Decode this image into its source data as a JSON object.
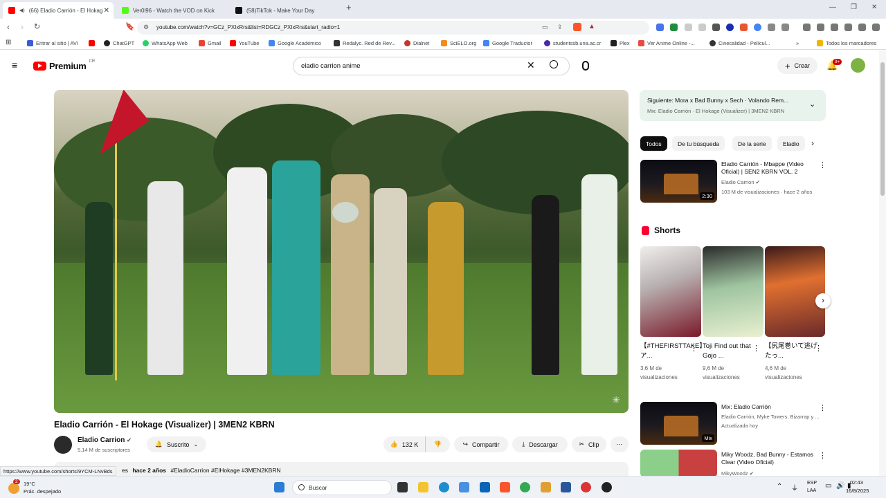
{
  "browser": {
    "tabs": [
      {
        "label": "(66) Eladio Carrión - El Hokag",
        "favicon_color": "#ff0000"
      },
      {
        "label": "Ver0l96 - Watch the VOD on Kick",
        "favicon_color": "#53fc18"
      },
      {
        "label": "(58)TikTok - Make Your Day",
        "favicon_color": "#111111"
      }
    ],
    "url": "youtube.com/watch?v=GCz_PXIxRrs&list=RDGCz_PXIxRrs&start_radio=1",
    "bookmarks": [
      {
        "label": "Entrar al sitio | AVI",
        "color": "#3b5bdb"
      },
      {
        "label": "",
        "color": "#ff0000"
      },
      {
        "label": "ChatGPT",
        "color": "#222222"
      },
      {
        "label": "WhatsApp Web",
        "color": "#25d366"
      },
      {
        "label": "Gmail",
        "color": "#ea4335"
      },
      {
        "label": "YouTube",
        "color": "#ff0000"
      },
      {
        "label": "Google Académico",
        "color": "#4285f4"
      },
      {
        "label": "Redalyc. Red de Rev...",
        "color": "#333333"
      },
      {
        "label": "Dialnet",
        "color": "#c0392b"
      },
      {
        "label": "SciELO.org",
        "color": "#f28b20"
      },
      {
        "label": "Google Traductor",
        "color": "#4285f4"
      },
      {
        "label": "studentssb.una.ac.cr",
        "color": "#4b2aa8"
      },
      {
        "label": "Plex",
        "color": "#1f1f1f"
      },
      {
        "label": "Ver Anime Online -...",
        "color": "#e74c3c"
      },
      {
        "label": "Cinecalidad - Películ...",
        "color": "#333333"
      }
    ],
    "all_bookmarks_label": "Todos los marcadores"
  },
  "header": {
    "logo": "Premium",
    "logo_region": "CR",
    "search_value": "eladio carrion anime",
    "create_label": "Crear",
    "notif_badge": "9+"
  },
  "video": {
    "title": "Eladio Carrión - El Hokage (Visualizer) | 3MEN2 KBRN",
    "channel": "Eladio Carrion",
    "subscribers": "5,14 M de suscriptores",
    "subscribed_label": "Suscrito",
    "likes": "132 K",
    "share_label": "Compartir",
    "download_label": "Descargar",
    "clip_label": "Clip",
    "desc_prefix": "es",
    "desc_time": "hace 2 años",
    "desc_tags": "#EladioCarrion #ElHokage #3MEN2KBRN"
  },
  "sidebar": {
    "next_title": "Siguiente: Mora x Bad Bunny x Sech · Volando Rem...",
    "next_sub": "Mix: Eladio Carrión · El Hokage (Visualizer) | 3MEN2 KBRN",
    "chips": [
      "Todos",
      "De tu búsqueda",
      "De la serie",
      "Eladio"
    ],
    "rec1": {
      "title": "Eladio Carrión - Mbappe (Video Oficial) | SEN2 KBRN VOL. 2",
      "channel": "Eladio Carrion",
      "meta": "103 M de visualizaciones · hace 2 años",
      "duration": "2:30"
    },
    "shorts_label": "Shorts",
    "shorts": [
      {
        "title": "【#THEFIRSTTAKE】ア...",
        "views": "3,6 M de",
        "views2": "visualizaciones"
      },
      {
        "title": "Toji Find out that Gojo ...",
        "views": "9,6 M de",
        "views2": "visualizaciones"
      },
      {
        "title": "【尻尾巻いて逃げたっ...",
        "views": "4,6 M de",
        "views2": "visualizaciones"
      }
    ],
    "rec2": {
      "title": "Mix: Eladio Carrión",
      "channel": "Eladio Carrión, Myke Towers, Bizarrap y ...",
      "meta": "Actualizada hoy",
      "badge": "Mix"
    },
    "rec3": {
      "title": "Miky Woodz, Bad Bunny - Estamos Clear (Video Oficial)",
      "channel": "MikyWoodz"
    }
  },
  "status_url": "https://www.youtube.com/shorts/9YCM-LNvBds",
  "taskbar": {
    "weather_temp": "19°C",
    "weather_desc": "Prác. despejado",
    "weather_badge": "2",
    "search_label": "Buscar",
    "lang1": "ESP",
    "lang2": "LAA",
    "time": "02:43",
    "date": "16/8/2025"
  },
  "icons": [
    "back-icon",
    "forward-icon",
    "reload-icon",
    "bookmark-icon",
    "menu-icon",
    "search-icon",
    "mic-icon",
    "bell-icon",
    "like-icon",
    "dislike-icon",
    "share-icon",
    "download-icon",
    "clip-icon",
    "more-icon",
    "chevron-icon",
    "windows-icon"
  ]
}
